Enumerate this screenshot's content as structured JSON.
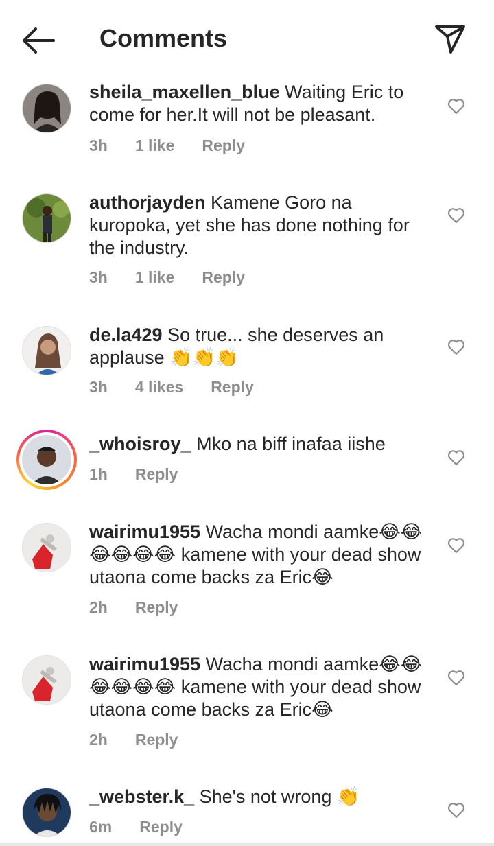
{
  "header": {
    "title": "Comments"
  },
  "comments": [
    {
      "username": "sheila_maxellen_blue",
      "text": "Waiting Eric to come for her.It will not be pleasant.",
      "time": "3h",
      "likes": "1 like",
      "reply": "Reply"
    },
    {
      "username": "authorjayden",
      "text": "Kamene Goro na kuropoka, yet she has done nothing for the industry.",
      "time": "3h",
      "likes": "1 like",
      "reply": "Reply"
    },
    {
      "username": "de.la429",
      "text": "So true... she deserves an applause 👏👏👏",
      "time": "3h",
      "likes": "4 likes",
      "reply": "Reply"
    },
    {
      "username": "_whoisroy_",
      "text": "Mko na biff inafaa iishe",
      "time": "1h",
      "likes": "",
      "reply": "Reply"
    },
    {
      "username": "wairimu1955",
      "text": "Wacha mondi aamke😂😂😂😂😂😂 kamene with your dead show utaona come backs za Eric😂",
      "time": "2h",
      "likes": "",
      "reply": "Reply"
    },
    {
      "username": "wairimu1955",
      "text": "Wacha mondi aamke😂😂😂😂😂😂 kamene with your dead show utaona come backs za Eric😂",
      "time": "2h",
      "likes": "",
      "reply": "Reply"
    },
    {
      "username": "_webster.k_",
      "text": "She's not wrong 👏",
      "time": "6m",
      "likes": "",
      "reply": "Reply"
    }
  ]
}
